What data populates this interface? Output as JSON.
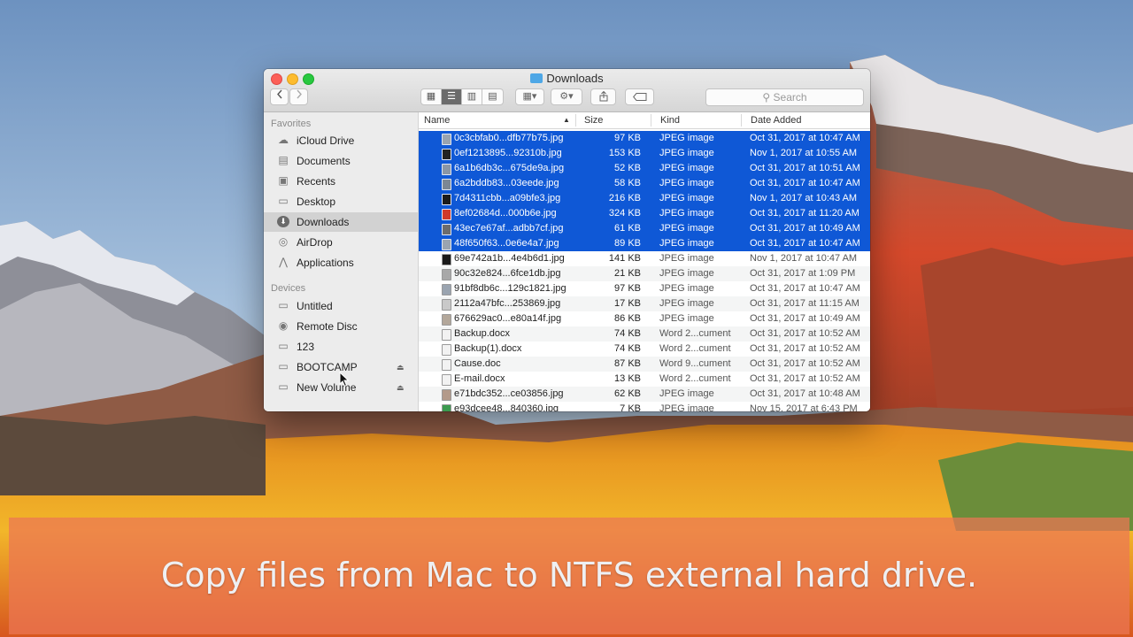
{
  "window": {
    "title": "Downloads"
  },
  "toolbar": {
    "back_icon": "chevron-left-icon",
    "forward_icon": "chevron-right-icon",
    "view_modes": [
      "icon-view-icon",
      "list-view-icon",
      "column-view-icon",
      "cover-flow-icon"
    ],
    "active_view": "list-view-icon",
    "search_placeholder": "Search"
  },
  "sidebar": {
    "favorites_heading": "Favorites",
    "favorites": [
      {
        "label": "iCloud Drive",
        "icon": "cloud-icon"
      },
      {
        "label": "Documents",
        "icon": "documents-icon"
      },
      {
        "label": "Recents",
        "icon": "recents-icon"
      },
      {
        "label": "Desktop",
        "icon": "desktop-icon"
      },
      {
        "label": "Downloads",
        "icon": "downloads-icon"
      },
      {
        "label": "AirDrop",
        "icon": "airdrop-icon"
      },
      {
        "label": "Applications",
        "icon": "applications-icon"
      }
    ],
    "devices_heading": "Devices",
    "devices": [
      {
        "label": "Untitled",
        "icon": "drive-icon"
      },
      {
        "label": "Remote Disc",
        "icon": "disc-icon"
      },
      {
        "label": "123",
        "icon": "drive-icon"
      },
      {
        "label": "BOOTCAMP",
        "icon": "drive-icon"
      },
      {
        "label": "New Volume",
        "icon": "drive-icon"
      }
    ]
  },
  "list": {
    "columns": {
      "name": "Name",
      "size": "Size",
      "kind": "Kind",
      "date": "Date Added"
    },
    "files": [
      {
        "name": "0c3cbfab0...dfb77b75.jpg",
        "size": "97 KB",
        "kind": "JPEG image",
        "date": "Oct 31, 2017 at 10:47 AM",
        "selected": true,
        "color": "#9aa4b0"
      },
      {
        "name": "0ef1213895...92310b.jpg",
        "size": "153 KB",
        "kind": "JPEG image",
        "date": "Nov 1, 2017 at 10:55 AM",
        "selected": true,
        "color": "#222222"
      },
      {
        "name": "6a1b6db3c...675de9a.jpg",
        "size": "52 KB",
        "kind": "JPEG image",
        "date": "Oct 31, 2017 at 10:51 AM",
        "selected": true,
        "color": "#8a96a6"
      },
      {
        "name": "6a2bddb83...03eede.jpg",
        "size": "58 KB",
        "kind": "JPEG image",
        "date": "Oct 31, 2017 at 10:47 AM",
        "selected": true,
        "color": "#7c8794"
      },
      {
        "name": "7d4311cbb...a09bfe3.jpg",
        "size": "216 KB",
        "kind": "JPEG image",
        "date": "Nov 1, 2017 at 10:43 AM",
        "selected": true,
        "color": "#1c1c1c"
      },
      {
        "name": "8ef02684d...000b6e.jpg",
        "size": "324 KB",
        "kind": "JPEG image",
        "date": "Oct 31, 2017 at 11:20 AM",
        "selected": true,
        "color": "#d0392b"
      },
      {
        "name": "43ec7e67af...adbb7cf.jpg",
        "size": "61 KB",
        "kind": "JPEG image",
        "date": "Oct 31, 2017 at 10:49 AM",
        "selected": true,
        "color": "#6d6d6d"
      },
      {
        "name": "48f650f63...0e6e4a7.jpg",
        "size": "89 KB",
        "kind": "JPEG image",
        "date": "Oct 31, 2017 at 10:47 AM",
        "selected": true,
        "color": "#9aa4b0"
      },
      {
        "name": "69e742a1b...4e4b6d1.jpg",
        "size": "141 KB",
        "kind": "JPEG image",
        "date": "Nov 1, 2017 at 10:47 AM",
        "selected": false,
        "color": "#1a1a1a"
      },
      {
        "name": "90c32e824...6fce1db.jpg",
        "size": "21 KB",
        "kind": "JPEG image",
        "date": "Oct 31, 2017 at 1:09 PM",
        "selected": false,
        "color": "#a8a8a8"
      },
      {
        "name": "91bf8db6c...129c1821.jpg",
        "size": "97 KB",
        "kind": "JPEG image",
        "date": "Oct 31, 2017 at 10:47 AM",
        "selected": false,
        "color": "#9aa4b0"
      },
      {
        "name": "2112a47bfc...253869.jpg",
        "size": "17 KB",
        "kind": "JPEG image",
        "date": "Oct 31, 2017 at 11:15 AM",
        "selected": false,
        "color": "#c9c9c9"
      },
      {
        "name": "676629ac0...e80a14f.jpg",
        "size": "86 KB",
        "kind": "JPEG image",
        "date": "Oct 31, 2017 at 10:49 AM",
        "selected": false,
        "color": "#b3a79a"
      },
      {
        "name": "Backup.docx",
        "size": "74 KB",
        "kind": "Word 2...cument",
        "date": "Oct 31, 2017 at 10:52 AM",
        "selected": false,
        "color": "#f2f2f2"
      },
      {
        "name": "Backup(1).docx",
        "size": "74 KB",
        "kind": "Word 2...cument",
        "date": "Oct 31, 2017 at 10:52 AM",
        "selected": false,
        "color": "#f2f2f2"
      },
      {
        "name": "Cause.doc",
        "size": "87 KB",
        "kind": "Word 9...cument",
        "date": "Oct 31, 2017 at 10:52 AM",
        "selected": false,
        "color": "#f2f2f2"
      },
      {
        "name": "E-mail.docx",
        "size": "13 KB",
        "kind": "Word 2...cument",
        "date": "Oct 31, 2017 at 10:52 AM",
        "selected": false,
        "color": "#f2f2f2"
      },
      {
        "name": "e71bdc352...ce03856.jpg",
        "size": "62 KB",
        "kind": "JPEG image",
        "date": "Oct 31, 2017 at 10:48 AM",
        "selected": false,
        "color": "#b39a8a"
      },
      {
        "name": "e93dcee48...840360.jpg",
        "size": "7 KB",
        "kind": "JPEG image",
        "date": "Nov 15, 2017 at 6:43 PM",
        "selected": false,
        "color": "#3b9a4f"
      }
    ]
  },
  "caption": {
    "text": "Copy files from Mac to NTFS external hard drive."
  }
}
